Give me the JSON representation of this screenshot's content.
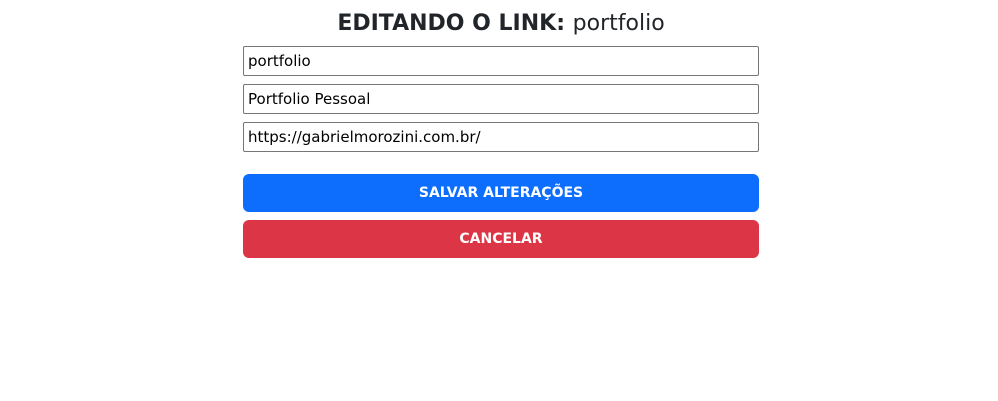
{
  "header": {
    "prefix": "EDITANDO O LINK:",
    "link_name": "portfolio"
  },
  "form": {
    "fields": [
      {
        "value": "portfolio"
      },
      {
        "value": "Portfolio Pessoal"
      },
      {
        "value": "https://gabrielmorozini.com.br/"
      }
    ],
    "save_label": "SALVAR ALTERAÇÕES",
    "cancel_label": "CANCELAR"
  },
  "colors": {
    "save_button": "#0d6efd",
    "cancel_button": "#dc3545",
    "text": "#212529"
  }
}
